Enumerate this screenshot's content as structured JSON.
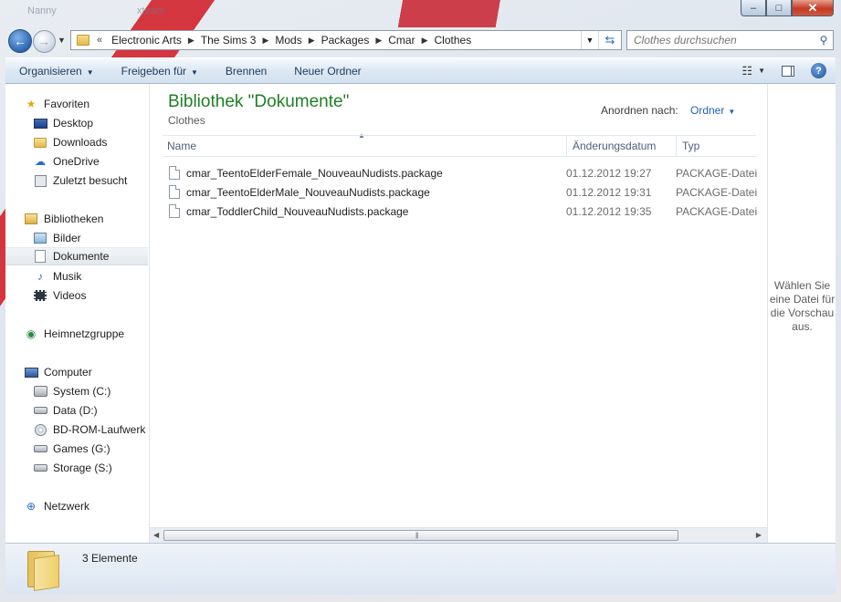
{
  "window": {
    "ghost_titles": [
      "Nanny",
      "xteam"
    ],
    "caption": {
      "minimize": "–",
      "maximize": "□",
      "close": "✕"
    }
  },
  "nav": {
    "back_icon": "arrow-left-icon",
    "forward_icon": "arrow-right-icon",
    "breadcrumb": [
      "Electronic Arts",
      "The Sims 3",
      "Mods",
      "Packages",
      "Cmar",
      "Clothes"
    ],
    "overflow": "«",
    "search_placeholder": "Clothes durchsuchen"
  },
  "toolbar": {
    "organize": "Organisieren",
    "share": "Freigeben für",
    "burn": "Brennen",
    "new_folder": "Neuer Ordner",
    "help": "?"
  },
  "sidebar": {
    "favorites": {
      "label": "Favoriten",
      "items": [
        "Desktop",
        "Downloads",
        "OneDrive",
        "Zuletzt besucht"
      ]
    },
    "libraries": {
      "label": "Bibliotheken",
      "items": [
        "Bilder",
        "Dokumente",
        "Musik",
        "Videos"
      ],
      "selected": "Dokumente"
    },
    "homegroup": "Heimnetzgruppe",
    "computer": {
      "label": "Computer",
      "items": [
        "System (C:)",
        "Data (D:)",
        "BD-ROM-Laufwerk (",
        "Games (G:)",
        "Storage (S:)"
      ]
    },
    "network": "Netzwerk"
  },
  "main": {
    "library_title": "Bibliothek \"Dokumente\"",
    "library_subtitle": "Clothes",
    "arrange_label": "Anordnen nach:",
    "arrange_value": "Ordner",
    "columns": {
      "name": "Name",
      "date": "Änderungsdatum",
      "type": "Typ"
    },
    "files": [
      {
        "name": "cmar_TeentoElderFemale_NouveauNudists.package",
        "date": "01.12.2012 19:27",
        "type": "PACKAGE-Datei"
      },
      {
        "name": "cmar_TeentoElderMale_NouveauNudists.package",
        "date": "01.12.2012 19:31",
        "type": "PACKAGE-Datei"
      },
      {
        "name": "cmar_ToddlerChild_NouveauNudists.package",
        "date": "01.12.2012 19:35",
        "type": "PACKAGE-Datei"
      }
    ]
  },
  "preview": {
    "message": "Wählen Sie eine Datei für die Vorschau aus."
  },
  "details": {
    "count": "3 Elemente"
  },
  "colors": {
    "accent_title": "#1e7f23",
    "link": "#1f5fb8",
    "close_button": "#c33a22"
  }
}
